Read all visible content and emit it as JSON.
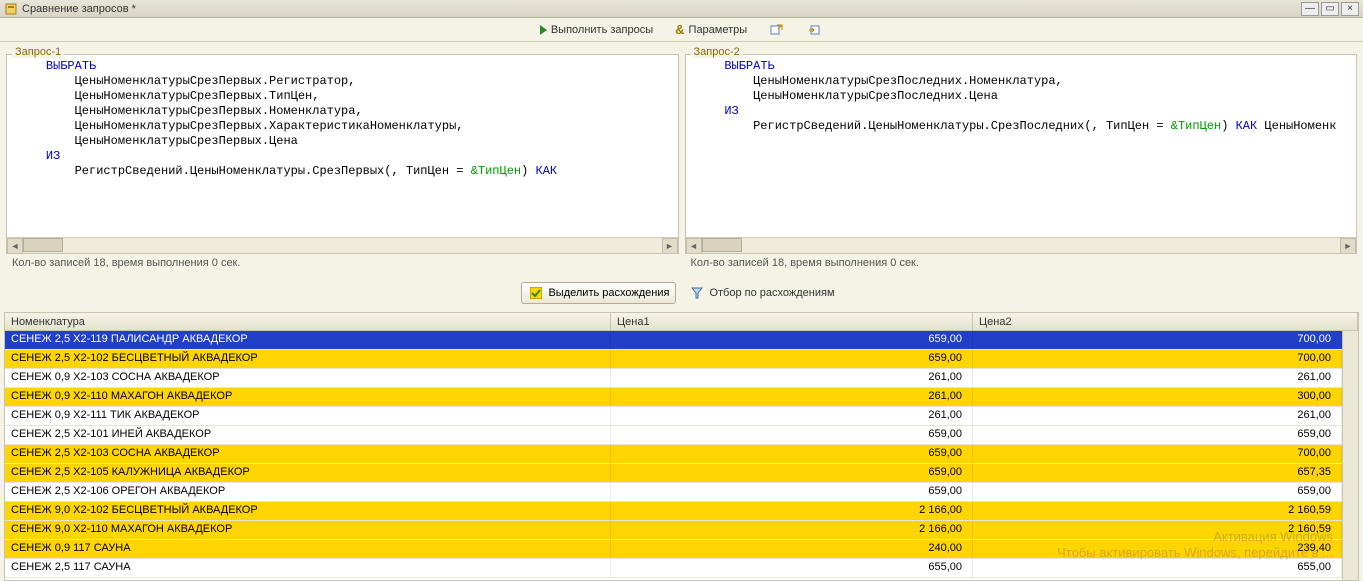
{
  "window": {
    "title": "Сравнение запросов *"
  },
  "toolbar": {
    "run_label": "Выполнить запросы",
    "params_label": "Параметры"
  },
  "query1": {
    "label": "Запрос-1",
    "status": "Кол-во записей 18, время выполнения 0 сек.",
    "code_html": "    <span class='kw'>ВЫБРАТЬ</span>\n        ЦеныНоменклатурыСрезПервых.Регистратор,\n        ЦеныНоменклатурыСрезПервых.ТипЦен,\n        ЦеныНоменклатурыСрезПервых.Номенклатура,\n        ЦеныНоменклатурыСрезПервых.ХарактеристикаНоменклатуры,\n        ЦеныНоменклатурыСрезПервых.Цена\n    <span class='kw'>ИЗ</span>\n        РегистрСведений.ЦеныНоменклатуры.СрезПервых(, ТипЦен = <span class='param'>&ТипЦен</span>) <span class='kw'>КАК</span> "
  },
  "query2": {
    "label": "Запрос-2",
    "status": "Кол-во записей 18, время выполнения 0 сек.",
    "code_html": "    <span class='kw'>ВЫБРАТЬ</span>\n        ЦеныНоменклатурыСрезПоследних.Номенклатура,\n        ЦеныНоменклатурыСрезПоследних.Цена\n    <span class='kw'>ИЗ</span>\n        РегистрСведений.ЦеныНоменклатуры.СрезПоследних(, ТипЦен = <span class='param'>&ТипЦен</span>) <span class='kw'>КАК</span> ЦеныНоменк"
  },
  "mid_toolbar": {
    "highlight_label": "Выделить расхождения",
    "filter_label": "Отбор по расхождениям"
  },
  "table": {
    "headers": [
      "Номенклатура",
      "Цена1",
      "Цена2"
    ],
    "rows": [
      {
        "name": "СЕНЕЖ 2,5 Х2-119  ПАЛИСАНДР АКВАДЕКОР",
        "p1": "659,00",
        "p2": "700,00",
        "diff": true,
        "selected": true
      },
      {
        "name": "СЕНЕЖ 2,5 Х2-102 БЕСЦВЕТНЫЙ АКВАДЕКОР",
        "p1": "659,00",
        "p2": "700,00",
        "diff": true
      },
      {
        "name": "СЕНЕЖ 0,9 Х2-103 СОСНА АКВАДЕКОР",
        "p1": "261,00",
        "p2": "261,00",
        "diff": false
      },
      {
        "name": "СЕНЕЖ 0,9 Х2-110 МАХАГОН АКВАДЕКОР",
        "p1": "261,00",
        "p2": "300,00",
        "diff": true
      },
      {
        "name": "СЕНЕЖ 0,9 Х2-111 ТИК АКВАДЕКОР",
        "p1": "261,00",
        "p2": "261,00",
        "diff": false
      },
      {
        "name": "СЕНЕЖ 2,5 Х2-101 ИНЕЙ АКВАДЕКОР",
        "p1": "659,00",
        "p2": "659,00",
        "diff": false
      },
      {
        "name": "СЕНЕЖ 2,5 Х2-103 СОСНА  АКВАДЕКОР",
        "p1": "659,00",
        "p2": "700,00",
        "diff": true
      },
      {
        "name": "СЕНЕЖ 2,5 Х2-105 КАЛУЖНИЦА АКВАДЕКОР",
        "p1": "659,00",
        "p2": "657,35",
        "diff": true
      },
      {
        "name": "СЕНЕЖ 2,5 Х2-106 ОРЕГОН АКВАДЕКОР",
        "p1": "659,00",
        "p2": "659,00",
        "diff": false
      },
      {
        "name": "СЕНЕЖ 9,0 Х2-102 БЕСЦВЕТНЫЙ АКВАДЕКОР",
        "p1": "2 166,00",
        "p2": "2 160,59",
        "diff": true
      },
      {
        "name": "СЕНЕЖ 9,0 Х2-110 МАХАГОН АКВАДЕКОР",
        "p1": "2 166,00",
        "p2": "2 160,59",
        "diff": true
      },
      {
        "name": "СЕНЕЖ 0,9 117 САУНА",
        "p1": "240,00",
        "p2": "239,40",
        "diff": true
      },
      {
        "name": "СЕНЕЖ 2,5 117 САУНА",
        "p1": "655,00",
        "p2": "655,00",
        "diff": false
      }
    ]
  },
  "watermark": {
    "line1": "Активация Windows",
    "line2": "Чтобы активировать Windows, перейдите в ..."
  }
}
